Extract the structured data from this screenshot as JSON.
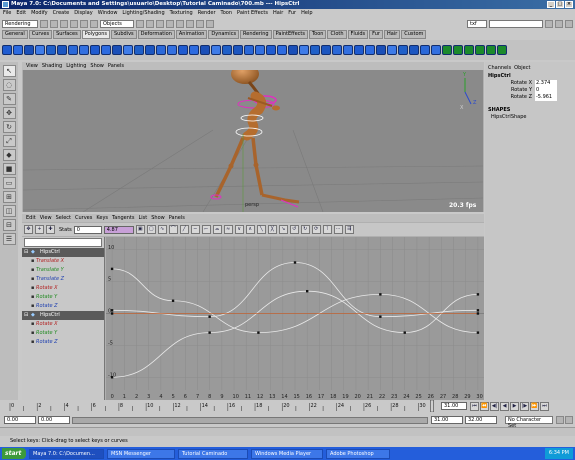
{
  "window": {
    "title": "Maya 7.0: C:\\Documents and Settings\\usuario\\Desktop\\Tutorial Caminado\\700.mb   ---   HipsCtrl",
    "controls": [
      "_",
      "□",
      "×"
    ]
  },
  "menubar": [
    "File",
    "Edit",
    "Modify",
    "Create",
    "Display",
    "Window",
    "Lighting/Shading",
    "Texturing",
    "Render",
    "Toon",
    "Paint Effects",
    "Hair",
    "Fur",
    "Help"
  ],
  "statusline": {
    "menu_set": "Rendering",
    "selection_mode": "Objects",
    "search_field": "txf",
    "render_field": ""
  },
  "shelf_tabs": [
    "General",
    "Curves",
    "Surfaces",
    "Polygons",
    "Subdivs",
    "Deformation",
    "Animation",
    "Dynamics",
    "Rendering",
    "PaintEffects",
    "Toon",
    "Cloth",
    "Fluids",
    "Fur",
    "Hair",
    "Custom"
  ],
  "active_shelf": "Polygons",
  "viewport": {
    "menu": [
      "View",
      "Shading",
      "Lighting",
      "Show",
      "Panels"
    ],
    "fps": "20.3 fps",
    "camera_label": "persp",
    "axis_labels": {
      "y": "Y",
      "z": "Z",
      "x": "X"
    }
  },
  "graph_editor": {
    "menu": [
      "Edit",
      "View",
      "Select",
      "Curves",
      "Keys",
      "Tangents",
      "List",
      "Show",
      "Panels"
    ],
    "stats_label": "Stats",
    "stats_frame": "0",
    "stats_value": "4.87",
    "y_ticks": [
      "10",
      "5",
      "0",
      "-5",
      "-10"
    ],
    "x_ticks": [
      "0",
      "1",
      "2",
      "3",
      "4",
      "5",
      "6",
      "7",
      "8",
      "9",
      "10",
      "11",
      "12",
      "13",
      "14",
      "15",
      "16",
      "17",
      "18",
      "19",
      "20",
      "21",
      "22",
      "23",
      "24",
      "25",
      "26",
      "27",
      "28",
      "29",
      "30"
    ],
    "outliner": [
      {
        "node": "HipsCtrl",
        "channels": [
          {
            "name": "Translate X",
            "color": "#b22222"
          },
          {
            "name": "Translate Y",
            "color": "#228b22"
          },
          {
            "name": "Translate Z",
            "color": "#1e3fb0"
          },
          {
            "name": "Rotate X",
            "color": "#b22222"
          },
          {
            "name": "Rotate Y",
            "color": "#228b22"
          },
          {
            "name": "Rotate Z",
            "color": "#1e3fb0"
          }
        ]
      },
      {
        "node": "HipsCtrl",
        "channels": [
          {
            "name": "Rotate X",
            "color": "#b22222"
          },
          {
            "name": "Rotate Y",
            "color": "#228b22"
          },
          {
            "name": "Rotate Z",
            "color": "#1e3fb0"
          }
        ]
      }
    ]
  },
  "channel_box": {
    "menu": [
      "Channels",
      "Object"
    ],
    "object": "HipsCtrl",
    "channels": [
      {
        "label": "Rotate X",
        "value": "2.374"
      },
      {
        "label": "Rotate Y",
        "value": "0"
      },
      {
        "label": "Rotate Z",
        "value": "-5.961"
      }
    ],
    "shapes_header": "SHAPES",
    "shape_name": "HipsCtrlShape"
  },
  "time_slider": {
    "ticks": [
      "0",
      "2",
      "4",
      "6",
      "8",
      "10",
      "12",
      "14",
      "16",
      "18",
      "20",
      "22",
      "24",
      "26",
      "28",
      "30"
    ],
    "current_time": "31.00"
  },
  "range_slider": {
    "start": "0.00",
    "range_start": "0.00",
    "range_end": "31.00",
    "end": "32.00",
    "character_set": "No Character Set"
  },
  "help_line": "Select keys: Click-drag to select keys or curves",
  "taskbar": {
    "start": "start",
    "tasks": [
      "Maya 7.0: C:\\Documen...",
      "MSN Messenger",
      "Tutorial Caminado",
      "Windows Media Player",
      "Adobe Photoshop"
    ],
    "active_task": 0,
    "clock": "6:34 PM"
  }
}
